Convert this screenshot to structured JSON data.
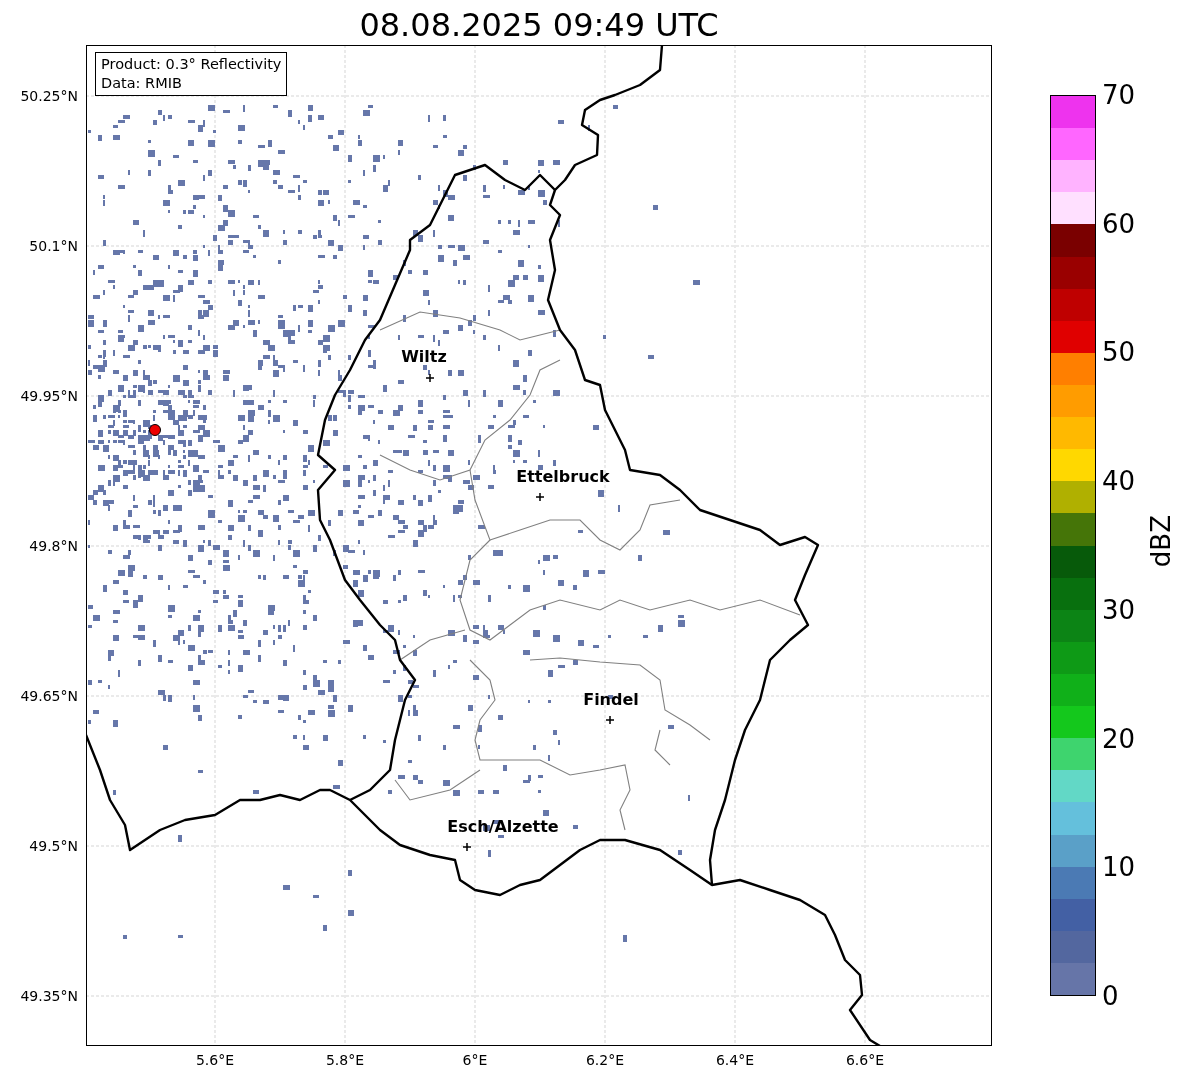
{
  "title": "08.08.2025 09:49 UTC",
  "info_box": {
    "lines": [
      "Product: 0.3° Reflectivity",
      "Data: RMIB"
    ]
  },
  "map": {
    "cities": [
      {
        "name": "Wiltz"
      },
      {
        "name": "Ettelbruck"
      },
      {
        "name": "Findel"
      },
      {
        "name": "Esch/Alzette"
      }
    ],
    "lat_ticks": [
      "50.25°N",
      "50.1°N",
      "49.95°N",
      "49.8°N",
      "49.65°N",
      "49.5°N",
      "49.35°N"
    ],
    "lon_ticks": [
      "5.6°E",
      "5.8°E",
      "6°E",
      "6.2°E",
      "6.4°E",
      "6.6°E"
    ]
  },
  "colorbar": {
    "label": "dBZ",
    "ticks": [
      "70",
      "60",
      "50",
      "40",
      "30",
      "20",
      "10",
      "0"
    ],
    "bins": [
      {
        "color": "#ee33ee"
      },
      {
        "color": "#ff66ff"
      },
      {
        "color": "#ffb3ff"
      },
      {
        "color": "#ffe0ff"
      },
      {
        "color": "#7a0000"
      },
      {
        "color": "#9a0000"
      },
      {
        "color": "#bf0000"
      },
      {
        "color": "#e00000"
      },
      {
        "color": "#ff7f00"
      },
      {
        "color": "#ff9c00"
      },
      {
        "color": "#ffb900"
      },
      {
        "color": "#ffd800"
      },
      {
        "color": "#b0b000"
      },
      {
        "color": "#457508"
      },
      {
        "color": "#075a0a"
      },
      {
        "color": "#08700e"
      },
      {
        "color": "#0c8415"
      },
      {
        "color": "#0e9a16"
      },
      {
        "color": "#10b019"
      },
      {
        "color": "#14c81c"
      },
      {
        "color": "#3ed46e"
      },
      {
        "color": "#62d8c6"
      },
      {
        "color": "#64c0dc"
      },
      {
        "color": "#5aa0c8"
      },
      {
        "color": "#4b7ab4"
      },
      {
        "color": "#4360a4"
      },
      {
        "color": "#53679f"
      },
      {
        "color": "#6675a8"
      }
    ]
  }
}
